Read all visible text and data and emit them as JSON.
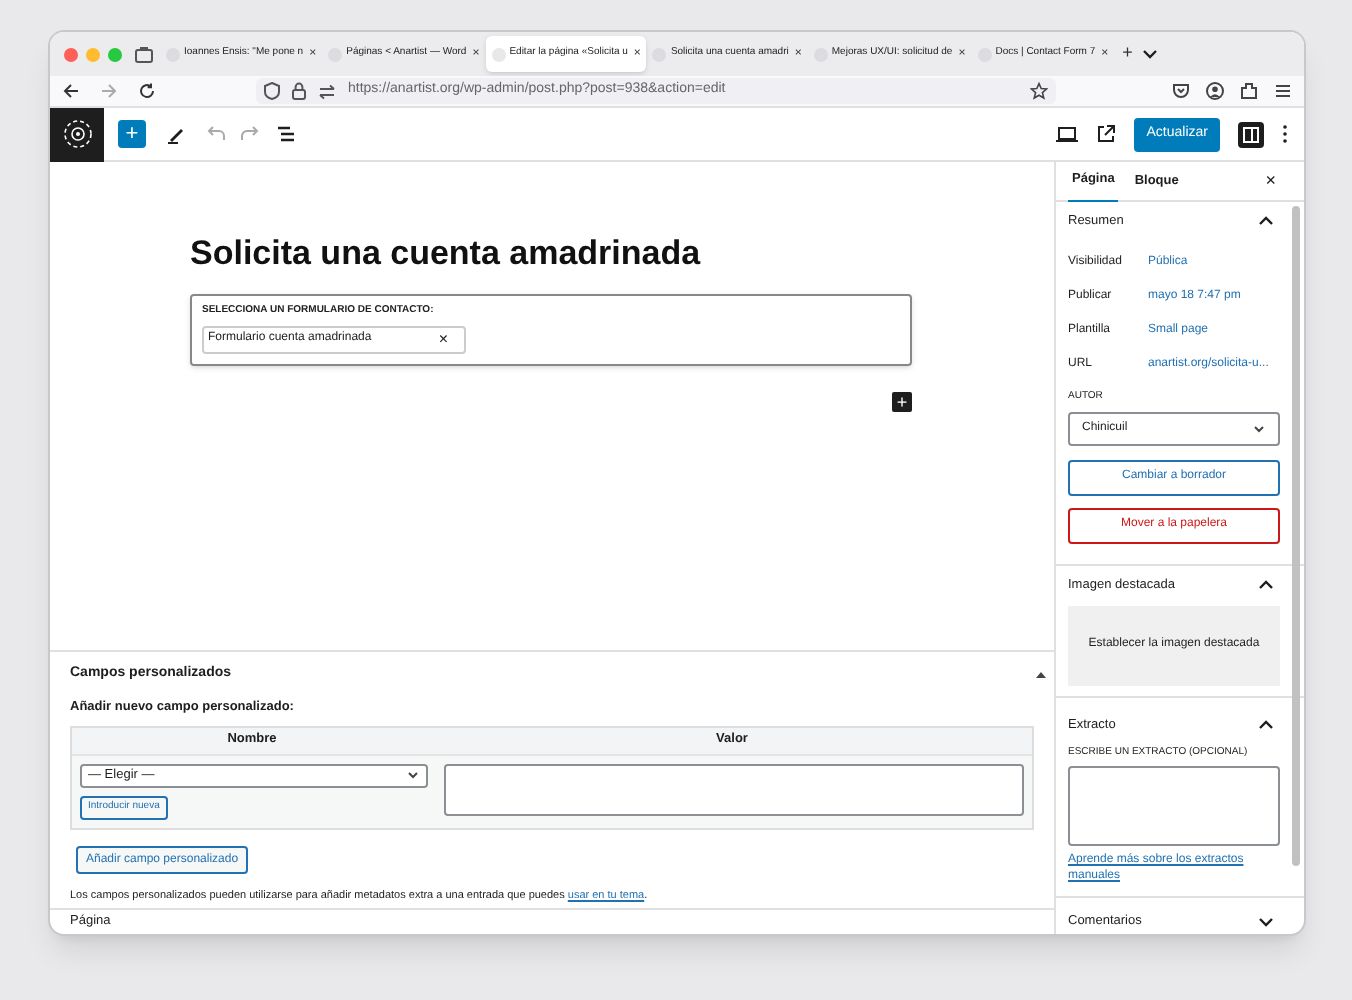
{
  "browser": {
    "tabs": [
      {
        "title": "Ioannes Ensis: \"Me pone n",
        "selected": false,
        "close": "×"
      },
      {
        "title": "Páginas < Anartist — Word",
        "selected": false,
        "close": "×"
      },
      {
        "title": "Editar la página «Solicita u",
        "selected": true,
        "close": "×"
      },
      {
        "title": "Solicita una cuenta amadri",
        "selected": false,
        "close": "×"
      },
      {
        "title": "Mejoras UX/UI: solicitud de",
        "selected": false,
        "close": "×"
      },
      {
        "title": "Docs | Contact Form 7",
        "selected": false,
        "close": "×"
      }
    ],
    "new_tab": "+",
    "url": "https://anartist.org/wp-admin/post.php?post=938&action=edit"
  },
  "toolbar": {
    "add": "+",
    "update_button": "Actualizar"
  },
  "editor": {
    "title": "Solicita una cuenta amadrinada",
    "block": {
      "label": "SELECCIONA UN FORMULARIO DE CONTACTO:",
      "value": "Formulario cuenta amadrinada",
      "clear": "×"
    },
    "inserter": "+"
  },
  "custom_fields": {
    "title": "Campos personalizados",
    "add_label": "Añadir nuevo campo personalizado:",
    "columns": [
      "Nombre",
      "Valor"
    ],
    "select": "— Elegir —",
    "new_button": "Introducir nueva",
    "add_button": "Añadir campo personalizado",
    "note": "Los campos personalizados pueden utilizarse para añadir metadatos extra a una entrada que puedes ",
    "note_link": "usar en tu tema",
    "note_end": "."
  },
  "status_bar": "Página",
  "sidebar": {
    "tabs": [
      {
        "label": "Página",
        "selected": true
      },
      {
        "label": "Bloque",
        "selected": false
      }
    ],
    "close": "×",
    "summary": {
      "title": "Resumen",
      "expanded": true,
      "rows": [
        {
          "label": "Visibilidad",
          "value": "Pública"
        },
        {
          "label": "Publicar",
          "value": "mayo 18 7:47 pm"
        },
        {
          "label": "Plantilla",
          "value": "Small page"
        },
        {
          "label": "URL",
          "value": "anartist.org/solicita-u..."
        }
      ],
      "author_label": "AUTOR",
      "author": "Chinicuil",
      "draft_button": "Cambiar a borrador",
      "trash_button": "Mover a la papelera"
    },
    "featured": {
      "title": "Imagen destacada",
      "expanded": true,
      "button": "Establecer la imagen destacada"
    },
    "excerpt": {
      "title": "Extracto",
      "expanded": true,
      "label": "ESCRIBE UN EXTRACTO (OPCIONAL)",
      "link": "Aprende más sobre los extractos manuales"
    },
    "comments": {
      "title": "Comentarios",
      "expanded": false
    }
  }
}
